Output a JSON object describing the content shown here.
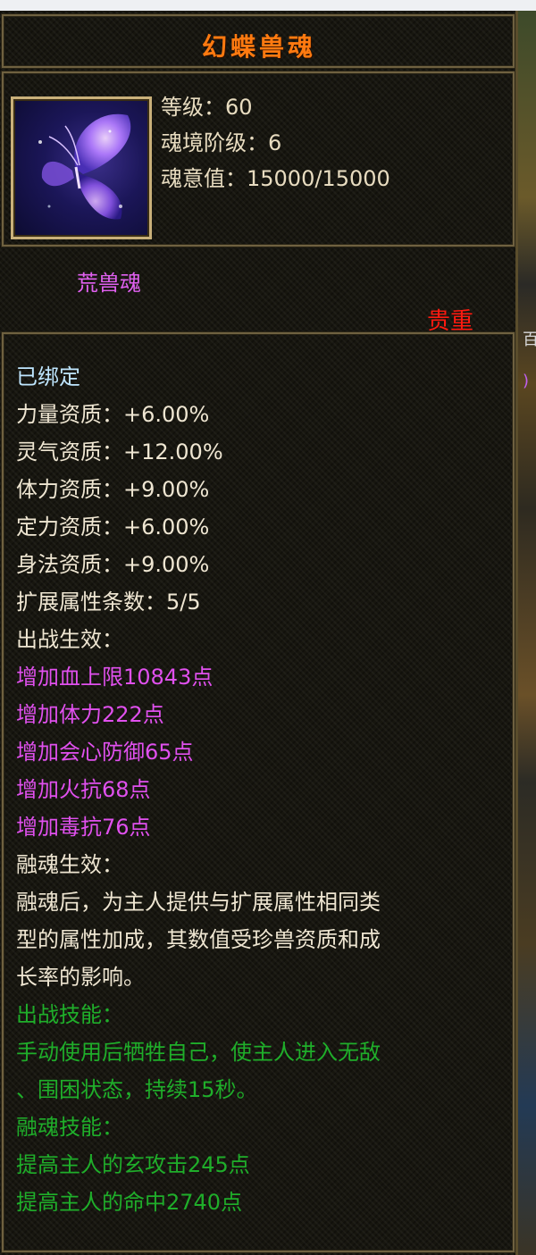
{
  "item": {
    "name": "幻蝶兽魂",
    "stats": {
      "level": "等级：60",
      "stage": "魂境阶级：6",
      "soul_value": "魂意值：15000/15000"
    },
    "category": "荒兽魂",
    "rarity": "贵重",
    "bound": "已绑定",
    "aptitudes": [
      "力量资质：+6.00%",
      "灵气资质：+12.00%",
      "体力资质：+9.00%",
      "定力资质：+6.00%",
      "身法资质：+9.00%"
    ],
    "ext_count": "扩展属性条数：5/5",
    "battle_effect_title": "出战生效：",
    "battle_effects": [
      "增加血上限10843点",
      "增加体力222点",
      "增加会心防御65点",
      "增加火抗68点",
      "增加毒抗76点"
    ],
    "fusion_effect_title": "融魂生效：",
    "fusion_desc": [
      "融魂后，为主人提供与扩展属性相同类",
      "型的属性加成，其数值受珍兽资质和成",
      "长率的影响。"
    ],
    "battle_skill_title": "出战技能：",
    "battle_skill": [
      "手动使用后牺牲自己，使主人进入无敌",
      "、围困状态，持续15秒。"
    ],
    "fusion_skill_title": "融魂技能：",
    "fusion_skills": [
      "提高主人的玄攻击245点",
      "提高主人的命中2740点"
    ]
  },
  "side_glyphs": [
    "百",
    ")"
  ],
  "colors": {
    "title": "#ff7a10",
    "purple": "#e050ee",
    "green": "#1fae2a",
    "rarity": "#ff1a10",
    "bound": "#bfe6ff"
  },
  "icon": "butterfly-icon"
}
